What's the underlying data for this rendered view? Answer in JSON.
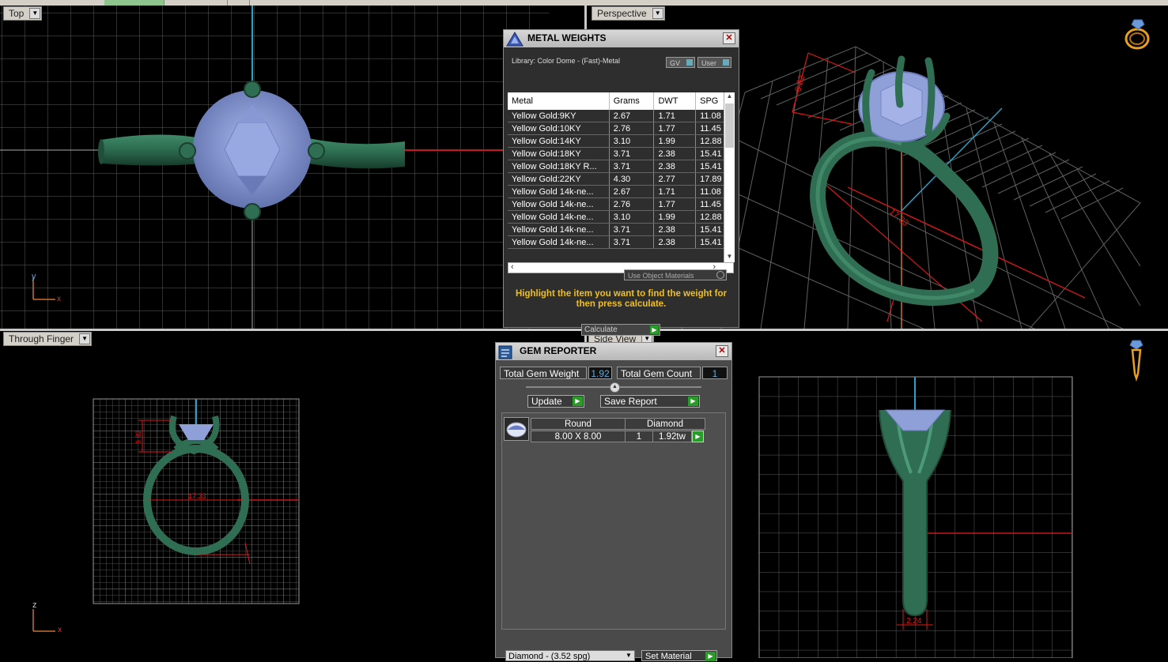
{
  "viewports": {
    "top_label": "Top",
    "perspective_label": "Perspective",
    "through_finger_label": "Through Finger",
    "side_view_label": "Side View"
  },
  "axes": {
    "top": {
      "a": "y",
      "b": "x"
    },
    "finger": {
      "a": "z",
      "b": "x"
    }
  },
  "dimensions": {
    "persp_height": "6.82",
    "persp_width": "17.33",
    "finger_height": "6.82",
    "finger_width": "17.33",
    "side_width": "2.24"
  },
  "metal_weights": {
    "title": "METAL WEIGHTS",
    "library": "Library: Color Dome - (Fast)-Metal",
    "gv_label": "GV",
    "user_label": "User",
    "columns": [
      "Metal",
      "Grams",
      "DWT",
      "SPG"
    ],
    "rows": [
      [
        "Yellow Gold:9KY",
        "2.67",
        "1.71",
        "11.08"
      ],
      [
        "Yellow Gold:10KY",
        "2.76",
        "1.77",
        "11.45"
      ],
      [
        "Yellow Gold:14KY",
        "3.10",
        "1.99",
        "12.88"
      ],
      [
        "Yellow Gold:18KY",
        "3.71",
        "2.38",
        "15.41"
      ],
      [
        "Yellow Gold:18KY R...",
        "3.71",
        "2.38",
        "15.41"
      ],
      [
        "Yellow Gold:22KY",
        "4.30",
        "2.77",
        "17.89"
      ],
      [
        "Yellow Gold 14k-ne...",
        "2.67",
        "1.71",
        "11.08"
      ],
      [
        "Yellow Gold 14k-ne...",
        "2.76",
        "1.77",
        "11.45"
      ],
      [
        "Yellow Gold 14k-ne...",
        "3.10",
        "1.99",
        "12.88"
      ],
      [
        "Yellow Gold 14k-ne...",
        "3.71",
        "2.38",
        "15.41"
      ],
      [
        "Yellow Gold 14k-ne...",
        "3.71",
        "2.38",
        "15.41"
      ]
    ],
    "use_object_materials": "Use Object Materials",
    "message": "Highlight the item you want to find the weight for then press calculate.",
    "calculate_label": "Calculate"
  },
  "gem_reporter": {
    "title": "GEM REPORTER",
    "total_weight_label": "Total Gem Weight",
    "total_weight_value": "1.92",
    "total_count_label": "Total Gem Count",
    "total_count_value": "1",
    "update_label": "Update",
    "save_report_label": "Save Report",
    "gems": [
      {
        "shape": "Round",
        "material": "Diamond",
        "size": "8.00 X 8.00",
        "count": "1",
        "weight": "1.92tw"
      }
    ],
    "material_select": "Diamond - (3.52 spg)",
    "set_material_label": "Set Material"
  },
  "colors": {
    "ring_green": "#2f6e52",
    "stone_blue": "#8fa0d8",
    "dim_red": "#e01818",
    "grid_gray": "#6a6a6a",
    "panel_gray": "#3a3a3a",
    "highlight_text": "#f0c020"
  },
  "icons": [
    "ring-icon",
    "pendant-icon",
    "metal-weights-icon",
    "gem-reporter-icon",
    "close-icon",
    "chevron-down-icon",
    "play-arrow-icon"
  ]
}
